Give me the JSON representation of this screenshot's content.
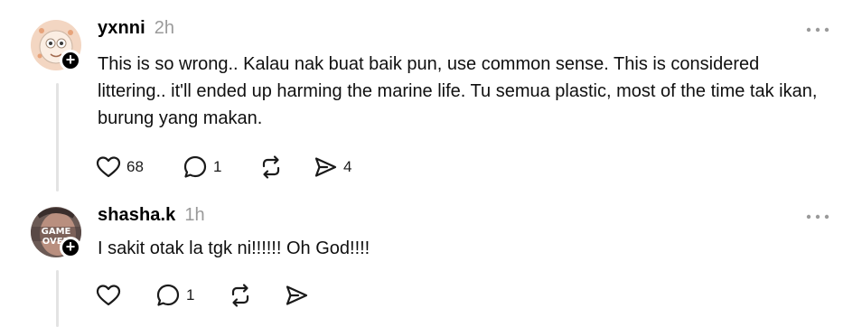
{
  "comments": [
    {
      "username": "yxnni",
      "time": "2h",
      "text": "This is so wrong.. Kalau nak buat baik pun, use common sense. This is considered littering.. it'll ended up harming the marine life. Tu semua plastic, most of the time tak ikan, burung yang makan.",
      "likes": "68",
      "replies": "1",
      "reposts": "",
      "shares": "4",
      "icons": {
        "like": "heart-icon",
        "reply": "comment-icon",
        "repost": "repost-icon",
        "share": "share-icon",
        "more": "more-dots-icon",
        "follow": "plus-icon"
      }
    },
    {
      "username": "shasha.k",
      "time": "1h",
      "text": "I sakit otak la tgk ni!!!!!! Oh God!!!!",
      "likes": "",
      "replies": "1",
      "reposts": "",
      "shares": "",
      "icons": {
        "like": "heart-icon",
        "reply": "comment-icon",
        "repost": "repost-icon",
        "share": "share-icon",
        "more": "more-dots-icon",
        "follow": "plus-icon"
      }
    }
  ],
  "colors": {
    "text": "#101010",
    "muted": "#9a9a9a",
    "thread_line": "#e3e3e3",
    "badge": "#000000"
  }
}
